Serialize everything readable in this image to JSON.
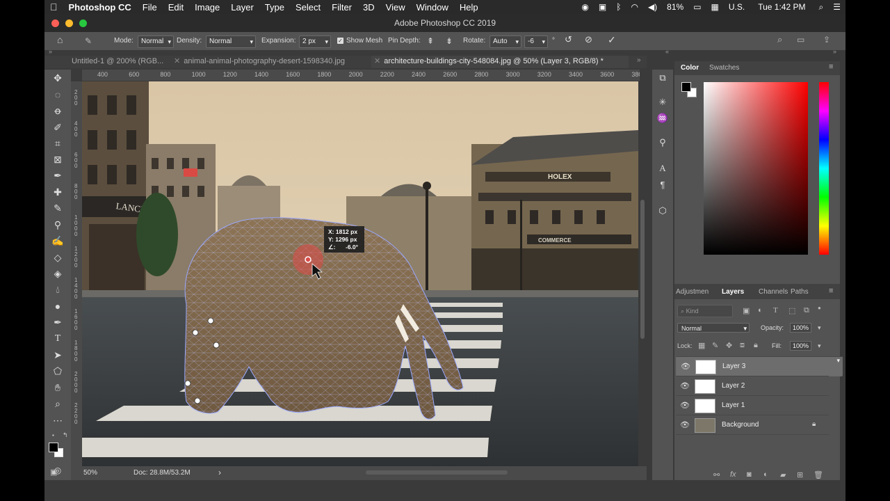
{
  "menubar": {
    "apple": "",
    "app_name": "Photoshop CC",
    "items": [
      "File",
      "Edit",
      "Image",
      "Layer",
      "Type",
      "Select",
      "Filter",
      "3D",
      "View",
      "Window",
      "Help"
    ],
    "battery": "81%",
    "locale": "U.S.",
    "clock": "Tue 1:42 PM"
  },
  "window": {
    "title": "Adobe Photoshop CC 2019"
  },
  "options": {
    "mode_label": "Mode:",
    "mode_value": "Normal",
    "density_label": "Density:",
    "density_value": "Normal",
    "expansion_label": "Expansion:",
    "expansion_value": "2 px",
    "show_mesh_label": "Show Mesh",
    "show_mesh_checked": true,
    "pin_depth_label": "Pin Depth:",
    "rotate_label": "Rotate:",
    "rotate_value": "Auto",
    "rotate_degrees": "-6",
    "degree_symbol": "°"
  },
  "tabs": [
    {
      "label": "Untitled-1 @ 200% (RGB...",
      "active": false
    },
    {
      "label": "animal-animal-photography-desert-1598340.jpg",
      "active": false
    },
    {
      "label": "architecture-buildings-city-548084.jpg @ 50% (Layer 3, RGB/8) *",
      "active": true
    }
  ],
  "ruler": {
    "h_ticks": [
      "400",
      "600",
      "800",
      "1000",
      "1200",
      "1400",
      "1600",
      "1800",
      "2000",
      "2200",
      "2400",
      "2600",
      "2800",
      "3000",
      "3200",
      "3400",
      "3600",
      "380"
    ],
    "v_ticks": [
      "2\n0\n0",
      "4\n0\n0",
      "6\n0\n0",
      "8\n0\n0",
      "1\n0\n0\n0",
      "1\n2\n0\n0",
      "1\n4\n0\n0",
      "1\n6\n0\n0",
      "1\n8\n0\n0",
      "2\n0\n0\n0",
      "2\n2\n0\n0"
    ]
  },
  "canvas": {
    "sign_lancel": "LANCEL",
    "sign_holex": "HOLEX",
    "sign_commerce": "COMMERCE",
    "readout_x": "X: 1812 px",
    "readout_y": "Y: 1296 px",
    "readout_angle": "-6.0°",
    "angle_glyph": "∠:"
  },
  "status": {
    "zoom": "50%",
    "doc": "Doc: 28.8M/53.2M",
    "arrow": "›"
  },
  "color_panel": {
    "tab_color": "Color",
    "tab_swatches": "Swatches"
  },
  "layers_panel": {
    "tab_adjustments": "Adjustmen",
    "tab_layers": "Layers",
    "tab_channels": "Channels",
    "tab_paths": "Paths",
    "filter_kind": "Kind",
    "blend_mode": "Normal",
    "opacity_label": "Opacity:",
    "opacity_value": "100%",
    "lock_label": "Lock:",
    "fill_label": "Fill:",
    "fill_value": "100%",
    "layers": [
      {
        "name": "Layer 3",
        "selected": true
      },
      {
        "name": "Layer 2",
        "selected": false
      },
      {
        "name": "Layer 1",
        "selected": false
      },
      {
        "name": "Background",
        "selected": false,
        "locked": true
      }
    ]
  },
  "colors": {
    "accent": "#c93a3a",
    "panel": "#535353",
    "mesh": "#9aa8ff"
  }
}
